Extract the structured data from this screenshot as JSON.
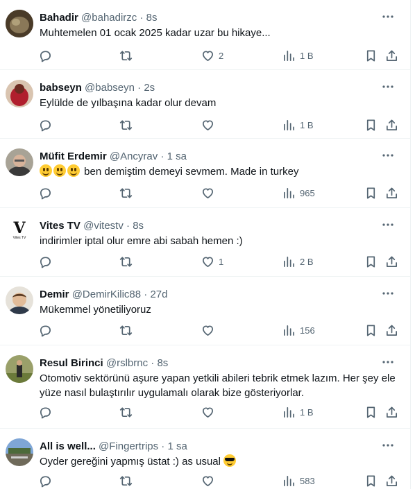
{
  "tweets": [
    {
      "name": "Bahadir",
      "handle": "@bahadirzc",
      "sep": "·",
      "time": "8s",
      "text": "Muhtemelen 01 ocak 2025 kadar uzar bu hikaye...",
      "likes": "2",
      "views": "1 B",
      "avatar_color": "#6b5a3f"
    },
    {
      "name": "babseyn",
      "handle": "@babseyn",
      "sep": "·",
      "time": "2s",
      "text": "Eylülde de yılbaşına kadar olur devam",
      "likes": "",
      "views": "1 B",
      "avatar_color": "#b01e2d"
    },
    {
      "name": "Müfit Erdemir",
      "handle": "@Ancyrav",
      "sep": "·",
      "time": "1 sa",
      "text": "ben demiştim demeyi sevmem. Made in turkey",
      "likes": "",
      "views": "965",
      "avatar_color": "#8c8a7e"
    },
    {
      "name": "Vites TV",
      "handle": "@vitestv",
      "sep": "·",
      "time": "8s",
      "text": "indirimler iptal olur emre abi sabah hemen :)",
      "likes": "1",
      "views": "2 B",
      "avatar_color": "#ffffff"
    },
    {
      "name": "Demir",
      "handle": "@DemirKilic88",
      "sep": "·",
      "time": "27d",
      "text": "Mükemmel yönetiliyoruz",
      "likes": "",
      "views": "156",
      "avatar_color": "#d9b38c"
    },
    {
      "name": "Resul Birinci",
      "handle": "@rslbrnc",
      "sep": "·",
      "time": "8s",
      "text": "Otomotiv sektörünü aşure yapan yetkili abileri tebrik etmek lazım. Her şey ele yüze nasıl bulaştırılır uygulamalı olarak bize gösteriyorlar.",
      "likes": "",
      "views": "1 B",
      "avatar_color": "#7c8a55"
    },
    {
      "name": "All is well...",
      "handle": "@Fingertrips",
      "sep": "·",
      "time": "1 sa",
      "text": "Oyder gereğini yapmış üstat :) as usual",
      "likes": "",
      "views": "583",
      "avatar_color": "#6a8bb5"
    }
  ],
  "vitestv_logo_text": "V",
  "vitestv_logo_sub": "Vites TV",
  "icons": {
    "reply": "reply-icon",
    "retweet": "retweet-icon",
    "like": "heart-icon",
    "views": "views-icon",
    "bookmark": "bookmark-icon",
    "share": "share-icon",
    "more": "more-icon"
  },
  "colors": {
    "text": "#0f1419",
    "muted": "#536471",
    "border": "#eff3f4"
  }
}
